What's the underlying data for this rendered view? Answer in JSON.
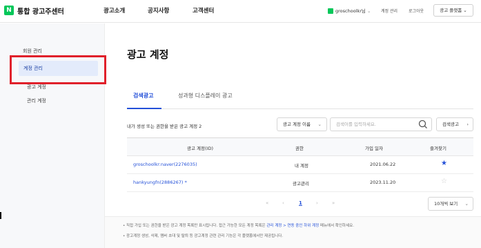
{
  "header": {
    "logo_letter": "N",
    "service_name": "통합 광고주센터",
    "nav": [
      "광고소개",
      "공지사항",
      "고객센터"
    ],
    "account": "groschoolkr님",
    "account_chevron": "⌄",
    "links": [
      "계정 관리",
      "로그아웃"
    ],
    "platform_button": "광고 플랫폼 ⌄"
  },
  "sidebar": {
    "items": [
      "회원 관리",
      "계정 관리",
      "광고 계정",
      "관리 계정"
    ],
    "active_index": 1
  },
  "main": {
    "title": "광고 계정",
    "tabs": [
      "검색광고",
      "성과형 디스플레이 광고"
    ],
    "active_tab": 0,
    "count_text": "내가 생성 또는 권한을 받은 광고 계정 2",
    "filter_select": "광고 계정 이름",
    "search_placeholder": "검색어를 입력하세요.",
    "search_button": "검색광고",
    "table": {
      "headers": [
        "광고 계정(ID)",
        "권한",
        "가입 일자",
        "즐겨찾기"
      ],
      "rows": [
        {
          "account": "groschoolkr:naver(2276035)",
          "role": "내 계정",
          "date": "2021.06.22",
          "favorite": true
        },
        {
          "account": "hankyungfn(2886267) *",
          "role": "광고관리",
          "date": "2023.11.20",
          "favorite": false
        }
      ]
    },
    "pagination": {
      "first": "«",
      "prev": "‹",
      "current": "1",
      "next": "›",
      "last": "»"
    },
    "per_page": "10개씩 보기",
    "notes": {
      "note1_a": "• 직접 가입 또는 권한을 받은 광고 계정 목록만 표시됩니다. 접근 가능한 모든 계정 목록은 ",
      "note1_hl": "관리 계정 > 연동 중인 하위 계정",
      "note1_b": " 메뉴에서 확인하세요.",
      "note2": "• 광고계정 생성, 삭제, 멤버 초대 및 탈퇴 등 광고계정 관련 관리 기능은 각 플랫폼에서만 제공됩니다."
    }
  },
  "colors": {
    "brand_green": "#03c75a",
    "accent_blue": "#2350d8",
    "annotation_red": "#e0202a"
  },
  "icons": {
    "search": "search-icon",
    "star": "star-icon"
  }
}
